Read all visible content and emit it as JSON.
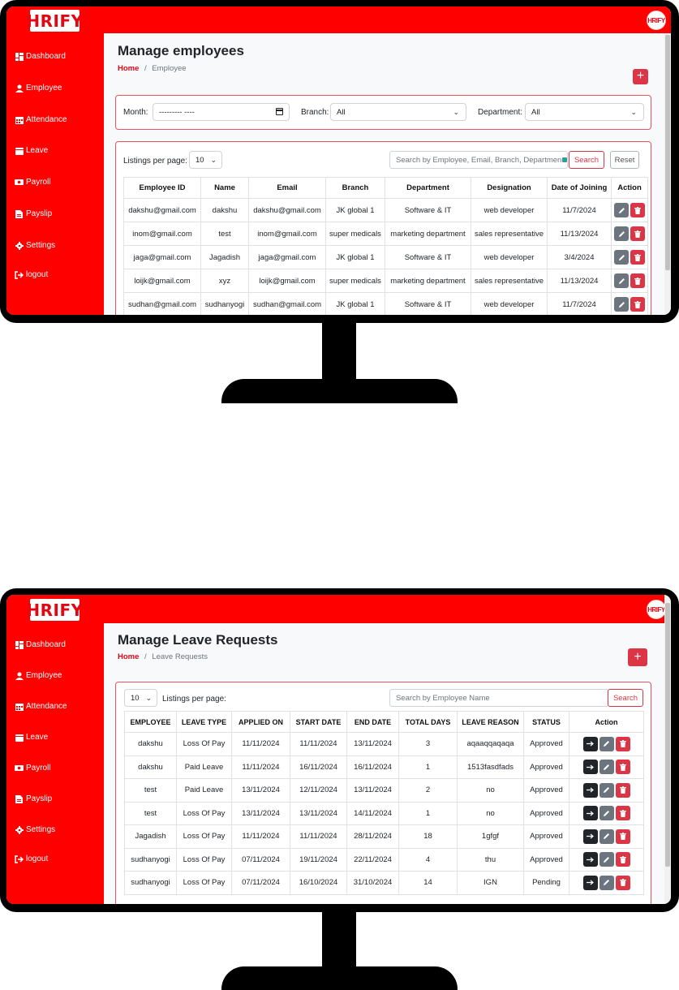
{
  "app": {
    "logo": "HRIFY",
    "avatar": "HRIFY"
  },
  "sidebar": {
    "items": [
      {
        "label": "Dashboard",
        "icon": "dashboard-icon"
      },
      {
        "label": "Employee",
        "icon": "person-icon"
      },
      {
        "label": "Attendance",
        "icon": "calendar-grid-icon"
      },
      {
        "label": "Leave",
        "icon": "calendar-icon"
      },
      {
        "label": "Payroll",
        "icon": "money-icon"
      },
      {
        "label": "Payslip",
        "icon": "document-icon"
      },
      {
        "label": "Settings",
        "icon": "gear-icon"
      },
      {
        "label": "logout",
        "icon": "logout-icon"
      }
    ]
  },
  "employees_screen": {
    "title": "Manage employees",
    "breadcrumb": {
      "home": "Home",
      "separator": "/",
      "current": "Employee"
    },
    "add_button": "+",
    "filters": {
      "month_label": "Month:",
      "month_value": "--------- ----",
      "branch_label": "Branch:",
      "branch_value": "All",
      "department_label": "Department:",
      "department_value": "All"
    },
    "listings_label": "Listings per page:",
    "listings_value": "10",
    "search_placeholder": "Search by Employee, Email, Branch, Departmen",
    "search_button": "Search",
    "reset_button": "Reset",
    "columns": [
      "Employee ID",
      "Name",
      "Email",
      "Branch",
      "Department",
      "Designation",
      "Date of Joining",
      "Action"
    ],
    "rows": [
      [
        "dakshu@gmail.com",
        "dakshu",
        "dakshu@gmail.com",
        "JK global 1",
        "Software & IT",
        "web developer",
        "11/7/2024"
      ],
      [
        "inom@gmail.com",
        "test",
        "inom@gmail.com",
        "super medicals",
        "marketing department",
        "sales representative",
        "11/13/2024"
      ],
      [
        "jaga@gmail.com",
        "Jagadish",
        "jaga@gmail.com",
        "JK global 1",
        "Software & IT",
        "web developer",
        "3/4/2024"
      ],
      [
        "loijk@gmail.com",
        "xyz",
        "loijk@gmail.com",
        "super medicals",
        "marketing department",
        "sales representative",
        "11/13/2024"
      ],
      [
        "sudhan@gmail.com",
        "sudhanyogi",
        "sudhan@gmail.com",
        "JK global 1",
        "Software & IT",
        "web developer",
        "11/7/2024"
      ]
    ]
  },
  "leave_screen": {
    "title": "Manage Leave Requests",
    "breadcrumb": {
      "home": "Home",
      "separator": "/",
      "current": "Leave Requests"
    },
    "add_button": "+",
    "listings_value": "10",
    "listings_label": "Listings per page:",
    "search_placeholder": "Search by Employee Name",
    "search_button": "Search",
    "columns": [
      "EMPLOYEE",
      "LEAVE TYPE",
      "APPLIED ON",
      "START DATE",
      "END DATE",
      "TOTAL DAYS",
      "LEAVE REASON",
      "STATUS",
      "Action"
    ],
    "rows": [
      [
        "dakshu",
        "Loss Of Pay",
        "11/11/2024",
        "11/11/2024",
        "13/11/2024",
        "3",
        "aqaaqqaqaqa",
        "Approved"
      ],
      [
        "dakshu",
        "Paid Leave",
        "11/11/2024",
        "16/11/2024",
        "16/11/2024",
        "1",
        "1513fasdfads",
        "Approved"
      ],
      [
        "test",
        "Paid Leave",
        "13/11/2024",
        "12/11/2024",
        "13/11/2024",
        "2",
        "no",
        "Approved"
      ],
      [
        "test",
        "Loss Of Pay",
        "13/11/2024",
        "13/11/2024",
        "14/11/2024",
        "1",
        "no",
        "Approved"
      ],
      [
        "Jagadish",
        "Loss Of Pay",
        "11/11/2024",
        "11/11/2024",
        "28/11/2024",
        "18",
        "1gfgf",
        "Approved"
      ],
      [
        "sudhanyogi",
        "Loss Of Pay",
        "07/11/2024",
        "19/11/2024",
        "22/11/2024",
        "4",
        "thu",
        "Approved"
      ],
      [
        "sudhanyogi",
        "Loss Of Pay",
        "07/11/2024",
        "16/10/2024",
        "31/10/2024",
        "14",
        "IGN",
        "Pending"
      ]
    ]
  },
  "colors": {
    "brand_red": "#ff0000",
    "danger": "#dc3545",
    "secondary": "#6c757d",
    "dark": "#212529"
  }
}
